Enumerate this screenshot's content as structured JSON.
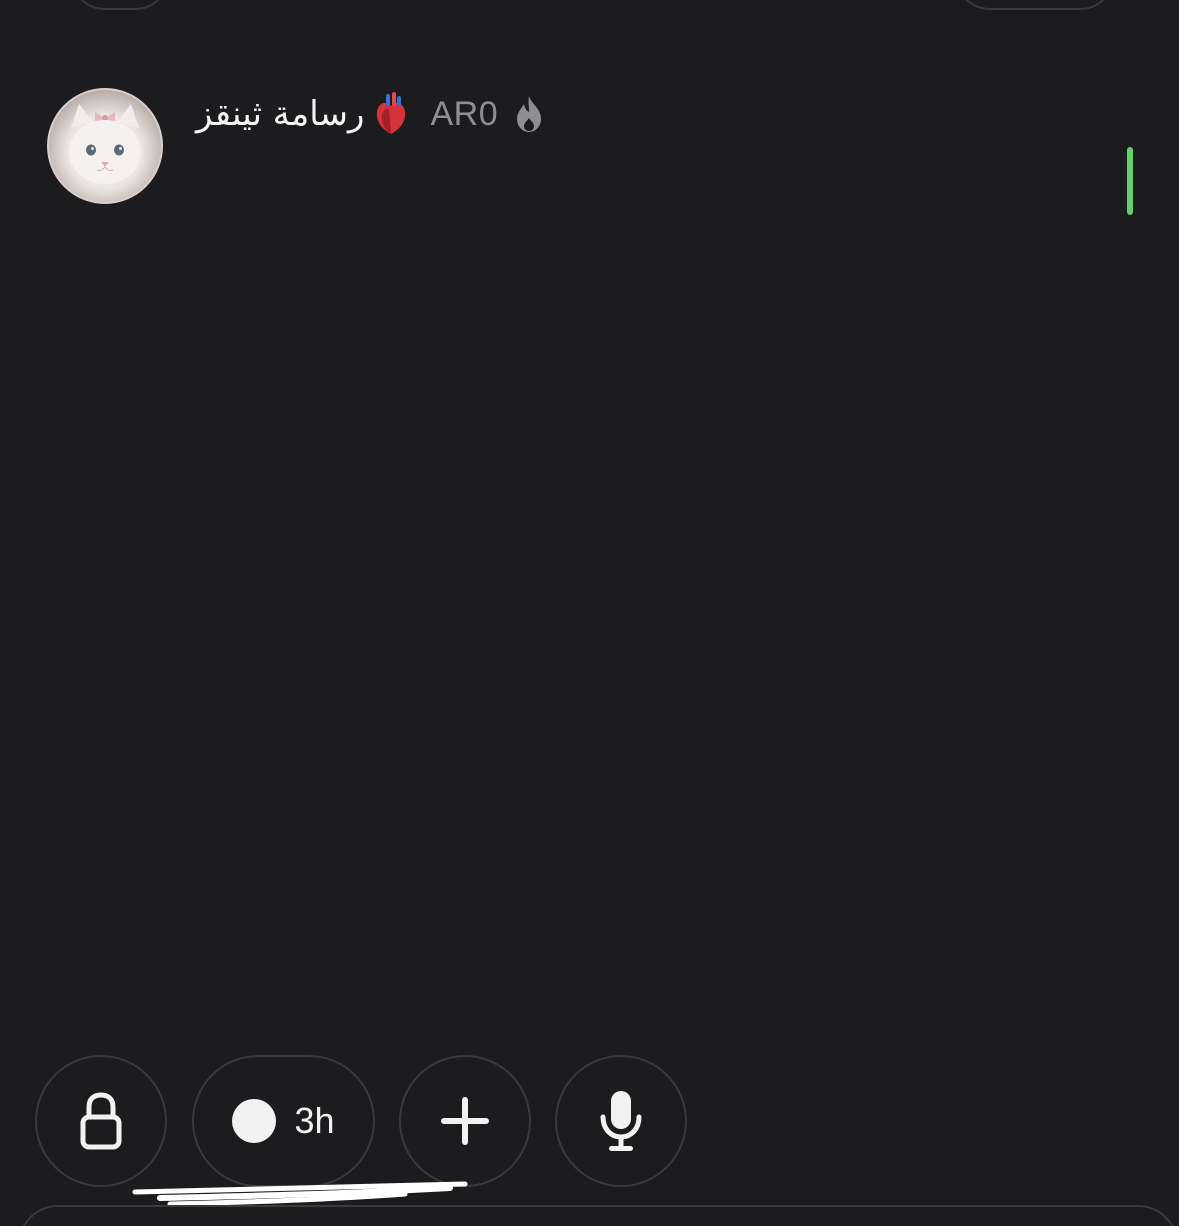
{
  "header": {
    "title": "رسامة ثينقز",
    "tag": "AR0",
    "icons": {
      "avatar": "cat-avatar",
      "heart": "anatomical-heart-icon",
      "flame": "flame-icon"
    }
  },
  "controls": {
    "lock": {
      "icon": "lock-icon"
    },
    "timer": {
      "icon": "dot-icon",
      "label": "3h"
    },
    "add": {
      "icon": "plus-icon"
    },
    "mic": {
      "icon": "microphone-icon"
    }
  },
  "colors": {
    "background": "#1c1c1e",
    "border": "#3a3a3c",
    "cursor": "#64d06a",
    "muted_text": "#8e8e93",
    "primary_text": "#f2f2f2"
  }
}
